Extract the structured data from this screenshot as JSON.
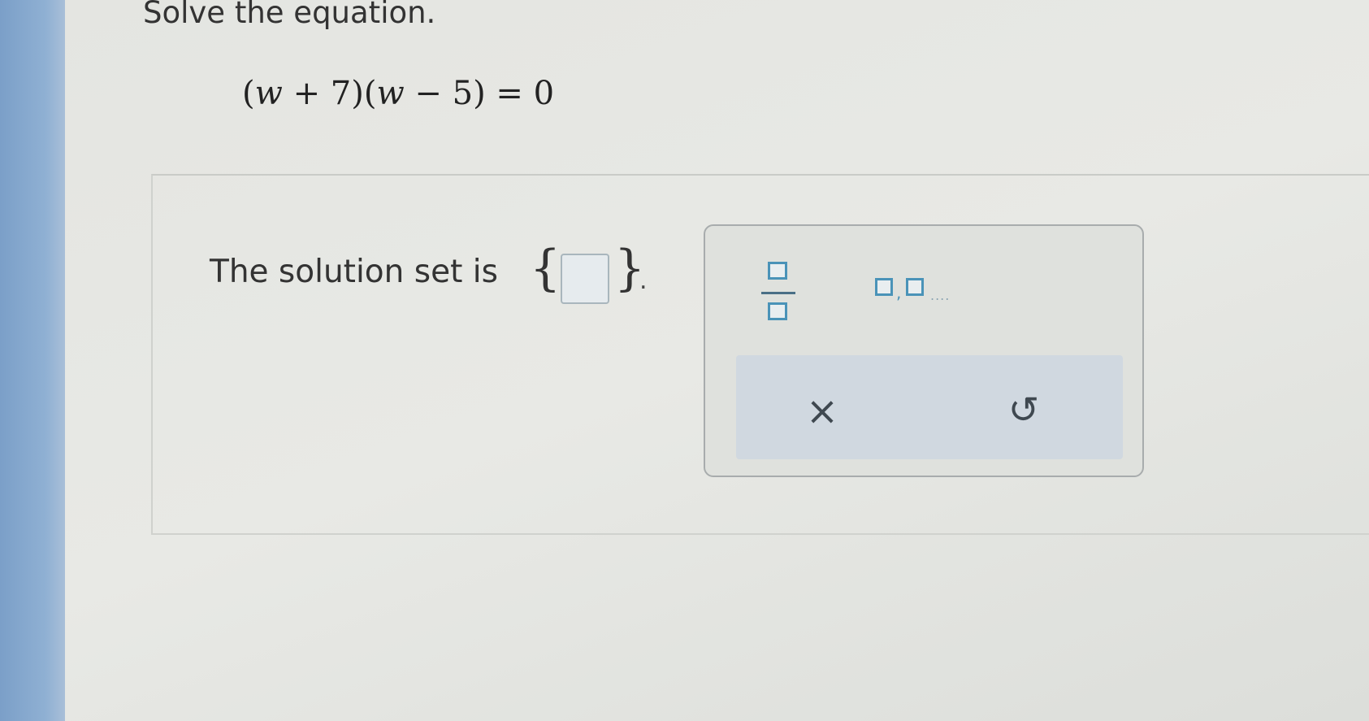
{
  "question": {
    "title": "Solve the equation.",
    "equation": {
      "open1": "(",
      "var1": "w",
      "part1": " + 7)(",
      "var2": "w",
      "part2": " − 5) = 0"
    }
  },
  "answer": {
    "label": "The solution set is",
    "brace_open": "{",
    "brace_close": "}",
    "value": "",
    "trailing": "."
  },
  "palette": {
    "fraction_icon": "fraction-template-icon",
    "list_icon": "comma-list-template-icon",
    "list_comma": ",",
    "list_dots": "....",
    "clear_symbol": "×",
    "undo_symbol": "↺",
    "accent_color": "#4a93b8"
  }
}
